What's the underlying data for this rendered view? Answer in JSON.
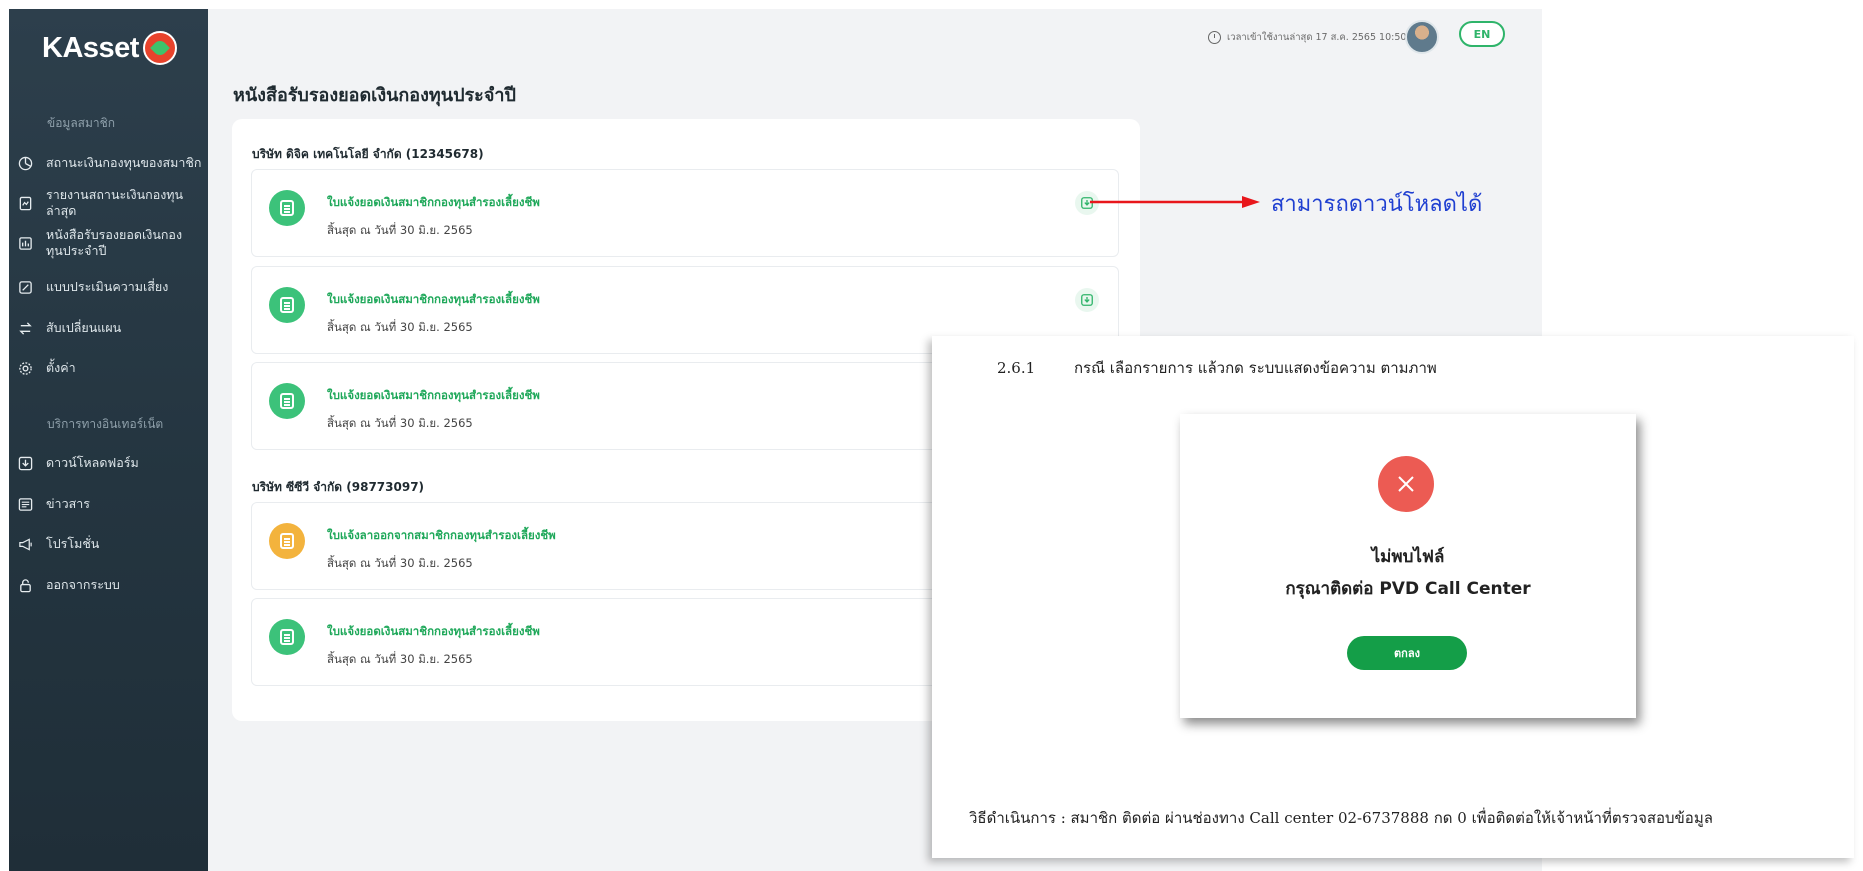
{
  "sidebar": {
    "logo_text": "KAsset",
    "section_member": "ข้อมูลสมาชิก",
    "items": [
      {
        "label": "สถานะเงินกองทุนของสมาชิก",
        "icon": "chart-icon"
      },
      {
        "label": "รายงานสถานะเงินกองทุน ล่าสุด",
        "icon": "report-icon"
      },
      {
        "label": "หนังสือรับรองยอดเงินกอง ทุนประจำปี",
        "icon": "certificate-icon"
      },
      {
        "label": "แบบประเมินความเสี่ยง",
        "icon": "edit-icon"
      },
      {
        "label": "สับเปลี่ยนแผน",
        "icon": "switch-icon"
      },
      {
        "label": "ตั้งค่า",
        "icon": "gear-icon"
      }
    ],
    "section_internet": "บริการทางอินเทอร์เน็ต",
    "items2": [
      {
        "label": "ดาวน์โหลดฟอร์ม",
        "icon": "download-icon"
      },
      {
        "label": "ข่าวสาร",
        "icon": "news-icon"
      },
      {
        "label": "โปรโมชั่น",
        "icon": "megaphone-icon"
      },
      {
        "label": "ออกจากระบบ",
        "icon": "lock-icon"
      }
    ]
  },
  "header": {
    "last_login": "เวลาเข้าใช้งานล่าสุด 17 ส.ค. 2565 10:50",
    "lang": "EN"
  },
  "page": {
    "title": "หนังสือรับรองยอดเงินกองทุนประจำปี",
    "companies": [
      {
        "name": "บริษัท ดิจิค เทคโนโลยี จำกัด (12345678)",
        "docs": [
          {
            "title": "ใบแจ้งยอดเงินสมาชิกกองทุนสำรองเลี้ยงชีพ",
            "subtitle": "สิ้นสุด ณ วันที่ 30 มิ.ย. 2565",
            "color": "#3cc27a"
          },
          {
            "title": "ใบแจ้งยอดเงินสมาชิกกองทุนสำรองเลี้ยงชีพ",
            "subtitle": "สิ้นสุด ณ วันที่ 30 มิ.ย. 2565",
            "color": "#3cc27a"
          },
          {
            "title": "ใบแจ้งยอดเงินสมาชิกกองทุนสำรองเลี้ยงชีพ",
            "subtitle": "สิ้นสุด ณ วันที่ 30 มิ.ย. 2565",
            "color": "#3cc27a"
          }
        ]
      },
      {
        "name": "บริษัท ซีซีวี จำกัด (98773097)",
        "docs": [
          {
            "title": "ใบแจ้งลาออกจากสมาชิกกองทุนสำรองเลี้ยงชีพ",
            "subtitle": "สิ้นสุด ณ วันที่ 30 มิ.ย. 2565",
            "color": "#f3b33d"
          },
          {
            "title": "ใบแจ้งยอดเงินสมาชิกกองทุนสำรองเลี้ยงชีพ",
            "subtitle": "สิ้นสุด ณ วันที่ 30 มิ.ย. 2565",
            "color": "#3cc27a"
          }
        ]
      }
    ]
  },
  "annotation": {
    "arrow_label": "สามารถดาวน์โหลดได้",
    "arrow_color": "#e8161b"
  },
  "doc_panel": {
    "step_number": "2.6.1",
    "step_text": "กรณี เลือกรายการ แล้วกด ระบบแสดงข้อความ ตามภาพ",
    "modal": {
      "line1": "ไม่พบไฟล์",
      "line2": "กรุณาติดต่อ PVD Call Center",
      "ok_label": "ตกลง"
    },
    "procedure": "วิธีดำเนินการ : สมาชิก ติดต่อ ผ่านช่องทาง Call center 02-6737888 กด 0 เพื่อติดต่อให้เจ้าหน้าที่ตรวจสอบข้อมูล"
  }
}
